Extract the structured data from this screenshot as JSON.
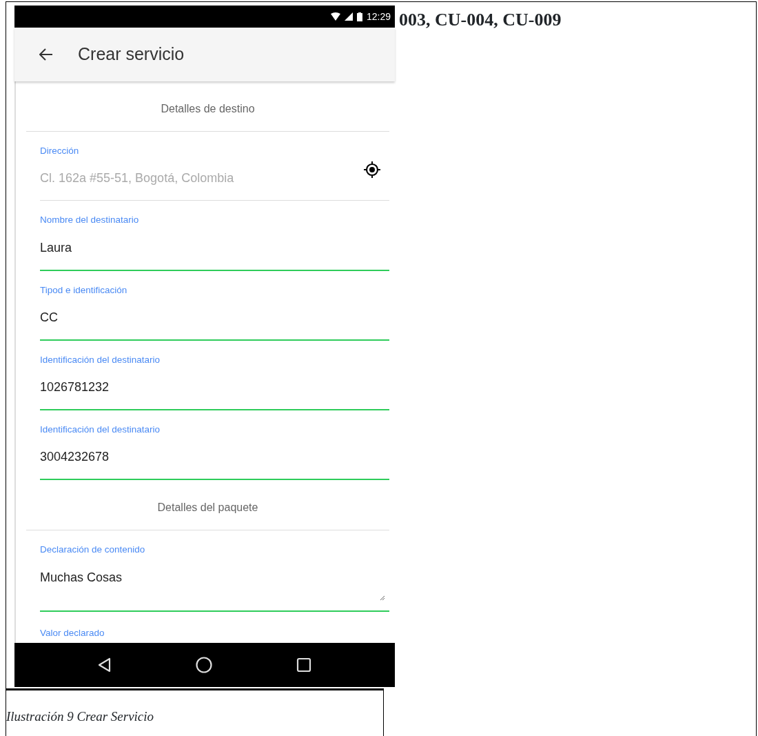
{
  "heading": "003, CU-004, CU-009",
  "status_bar": {
    "time": "12:29"
  },
  "app_bar": {
    "title": "Crear servicio"
  },
  "form": [
    {
      "kind": "section",
      "title": "Detalles de destino"
    },
    {
      "kind": "field",
      "label": "Dirección",
      "placeholder": "Cl. 162a #55-51, Bogotá, Colombia",
      "locate": true
    },
    {
      "kind": "field",
      "label": "Nombre del destinatario",
      "value": "Laura"
    },
    {
      "kind": "field",
      "label": "Tipod e identificación",
      "value": "CC"
    },
    {
      "kind": "field",
      "label": "Identificación del destinatario",
      "value": "1026781232"
    },
    {
      "kind": "field",
      "label": "Identificación del destinatario",
      "value": "3004232678"
    },
    {
      "kind": "section",
      "title": "Detalles del paquete"
    },
    {
      "kind": "textarea",
      "label": "Declaración de contenido",
      "value": "Muchas Cosas"
    },
    {
      "kind": "label",
      "label": "Valor declarado"
    }
  ],
  "caption": "Ilustración 9 Crear Servicio"
}
